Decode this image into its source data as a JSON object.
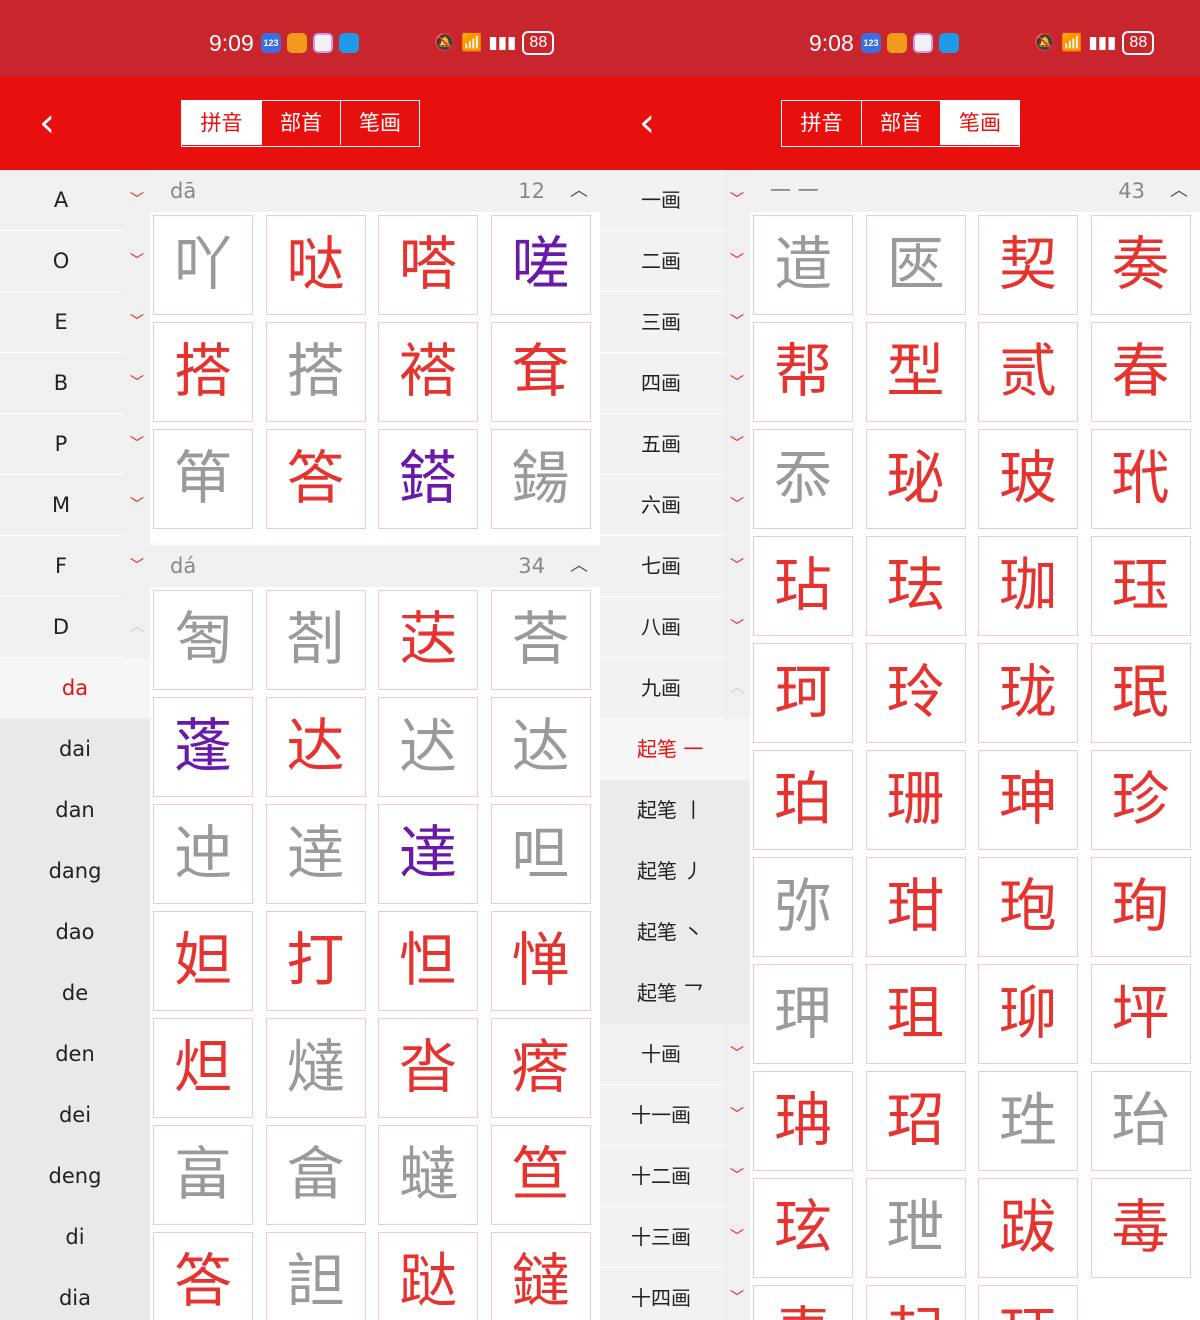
{
  "left": {
    "status": {
      "time": "9:09",
      "battery": "88"
    },
    "tabs": [
      {
        "label": "拼音"
      },
      {
        "label": "部首"
      },
      {
        "label": "笔画"
      }
    ],
    "active_tab": 0,
    "sidebar": {
      "letters": [
        "A",
        "O",
        "E",
        "B",
        "P",
        "M",
        "F",
        "D"
      ],
      "sub": [
        "da",
        "dai",
        "dan",
        "dang",
        "dao",
        "de",
        "den",
        "dei",
        "deng",
        "di",
        "dia"
      ]
    },
    "sections": [
      {
        "label": "dā",
        "count": "12",
        "chars": [
          "吖",
          "哒",
          "嗒",
          "嗟",
          "搭",
          "搭",
          "褡",
          "耷",
          "笚",
          "答",
          "鎝",
          "鍚"
        ]
      },
      {
        "label": "dá",
        "count": "34",
        "chars": [
          "匒",
          "剳",
          "荙",
          "荅",
          "蓬",
          "达",
          "迖",
          "迏",
          "迚",
          "逹",
          "達",
          "呾",
          "妲",
          "打",
          "怛",
          "惮",
          "炟",
          "燵",
          "沓",
          "瘩",
          "畗",
          "畣",
          "蟽",
          "笪",
          "答",
          "詚",
          "跶",
          "鐽"
        ]
      }
    ]
  },
  "right": {
    "status": {
      "time": "9:08",
      "battery": "88"
    },
    "tabs": [
      {
        "label": "拼音"
      },
      {
        "label": "部首"
      },
      {
        "label": "笔画"
      }
    ],
    "active_tab": 2,
    "sidebar": {
      "strokes_a": [
        "一画",
        "二画",
        "三画",
        "四画",
        "五画",
        "六画",
        "七画",
        "八画",
        "九画"
      ],
      "sub": [
        "起笔 一",
        "起笔 丨",
        "起笔 丿",
        "起笔 丶",
        "起笔 乛"
      ],
      "strokes_b": [
        "十画",
        "十一画",
        "十二画",
        "十三画",
        "十四画"
      ]
    },
    "sections": [
      {
        "label": "一 一",
        "count": "43",
        "chars": [
          "逪",
          "匧",
          "契",
          "奏",
          "帮",
          "型",
          "贰",
          "春",
          "忝",
          "珌",
          "玻",
          "玳",
          "玷",
          "珐",
          "珈",
          "珏",
          "珂",
          "玲",
          "珑",
          "珉",
          "珀",
          "珊",
          "珅",
          "珍",
          "弥",
          "玵",
          "玸",
          "珣",
          "玾",
          "珇",
          "珋",
          "坪",
          "珃",
          "玿",
          "珄",
          "珆",
          "玹",
          "玴",
          "跋",
          "毒",
          "青",
          "起",
          "珏"
        ]
      }
    ]
  }
}
